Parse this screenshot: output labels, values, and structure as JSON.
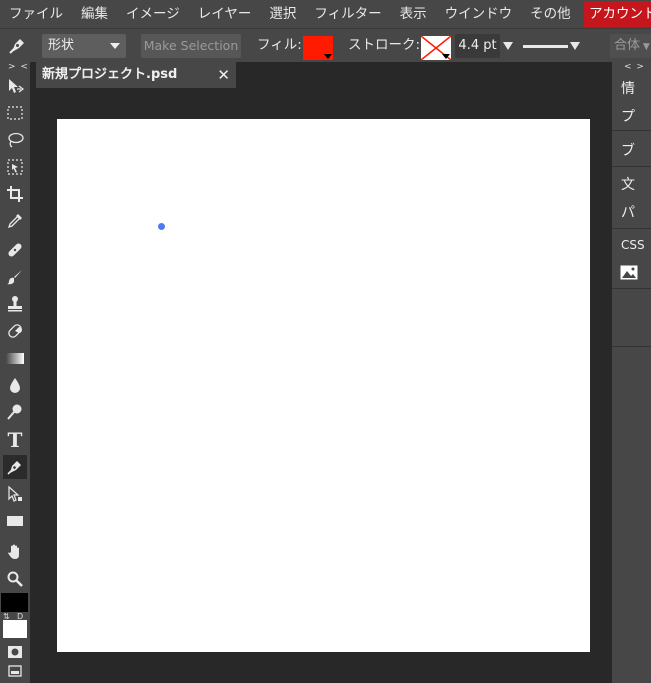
{
  "menu": {
    "items": [
      "ファイル",
      "編集",
      "イメージ",
      "レイヤー",
      "選択",
      "フィルター",
      "表示",
      "ウインドウ",
      "その他"
    ],
    "account": "アカウント"
  },
  "options": {
    "shape_select": "形状",
    "make_selection": "Make Selection",
    "fill_label": "フィル:",
    "fill_color": "#ff1a00",
    "stroke_label": "ストローク:",
    "stroke_width": "4.4 pt",
    "merge": "合体"
  },
  "document": {
    "tab_title": "新規プロジェクト.psd",
    "close": "✕"
  },
  "toolbar": {
    "collapse": "> <",
    "tools": [
      "move-icon",
      "marquee-icon",
      "lasso-icon",
      "quick-select-icon",
      "crop-icon",
      "eyedropper-icon",
      "healing-icon",
      "brush-icon",
      "stamp-icon",
      "eraser-icon",
      "gradient-icon",
      "blur-icon",
      "dodge-icon",
      "type-icon",
      "pen-icon",
      "path-select-icon",
      "rectangle-icon",
      "hand-icon",
      "zoom-icon"
    ],
    "type_tool": "T",
    "swap_label": "⇅",
    "default_label": "D",
    "foreground_color": "#000000",
    "background_color": "#ffffff"
  },
  "right_panel": {
    "collapse": "< >",
    "items": [
      "情",
      "プ",
      "ブ",
      "文",
      "パ",
      "CSS"
    ]
  }
}
